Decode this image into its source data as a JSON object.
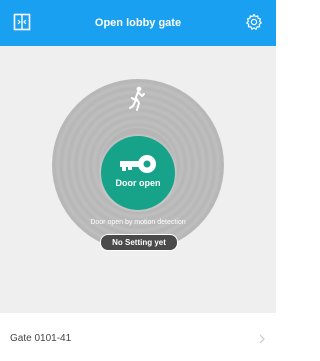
{
  "colors": {
    "accent": "#1aa0f0",
    "key_green": "#17a389",
    "disc_gray": "#b6b6b6",
    "pill_dark": "#4a4a4a"
  },
  "header": {
    "title": "Open lobby gate",
    "left_icon": "gate-panel-icon",
    "right_icon": "gear-icon"
  },
  "main": {
    "motion_icon": "walking-person-icon",
    "key_icon": "key-icon",
    "door_status": "Door open",
    "motion_detection_text": "Door open by motion detection",
    "setting_button": "No Setting yet"
  },
  "gate": {
    "name": "Gate 0101-41",
    "chevron_icon": "chevron-right-icon"
  }
}
